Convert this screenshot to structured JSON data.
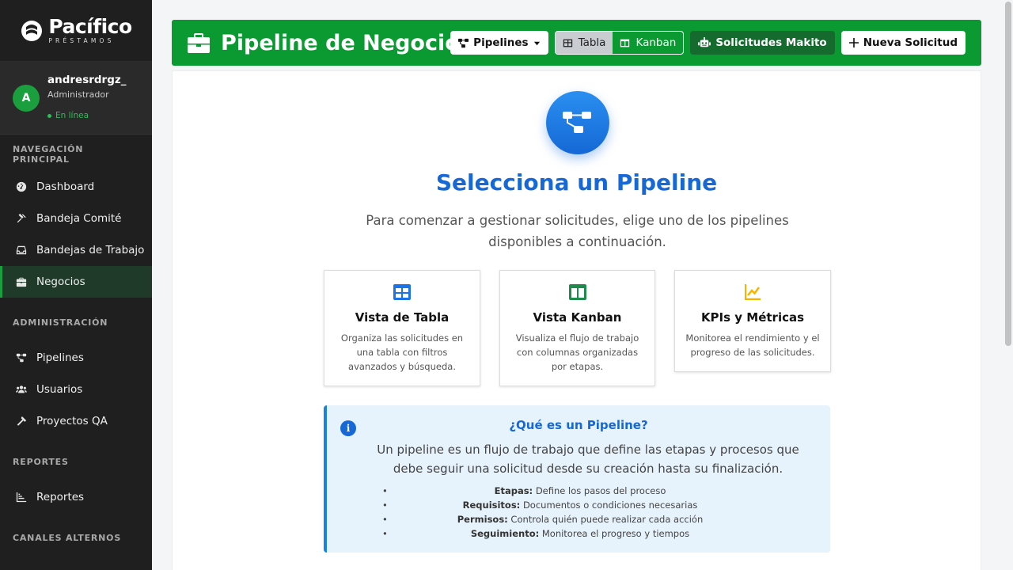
{
  "brand": {
    "name": "Pacífico",
    "sub": "PRÉSTAMOS"
  },
  "user": {
    "initial": "A",
    "name": "andresrdrgz_",
    "role": "Administrador",
    "status": "En línea"
  },
  "sidebar": {
    "sections": [
      {
        "title": "NAVEGACIÓN PRINCIPAL",
        "items": [
          {
            "label": "Dashboard",
            "icon": "gauge-icon"
          },
          {
            "label": "Bandeja Comité",
            "icon": "gavel-icon"
          },
          {
            "label": "Bandejas de Trabajo",
            "icon": "inbox-icon"
          },
          {
            "label": "Negocios",
            "icon": "briefcase-icon",
            "active": true
          }
        ]
      },
      {
        "title": "ADMINISTRACIÓN",
        "items": [
          {
            "label": "Pipelines",
            "icon": "sitemap-icon"
          },
          {
            "label": "Usuarios",
            "icon": "users-icon"
          },
          {
            "label": "Proyectos QA",
            "icon": "hammer-icon"
          }
        ]
      },
      {
        "title": "REPORTES",
        "items": [
          {
            "label": "Reportes",
            "icon": "chart-list-icon"
          }
        ]
      },
      {
        "title": "CANALES ALTERNOS",
        "items": []
      }
    ]
  },
  "header": {
    "title": "Pipeline de Negocio",
    "pipelines_label": "Pipelines",
    "view_table_label": "Tabla",
    "view_kanban_label": "Kanban",
    "makito_label": "Solicitudes Makito",
    "new_label": "Nueva Solicitud"
  },
  "main": {
    "title": "Selecciona un Pipeline",
    "subtitle": "Para comenzar a gestionar solicitudes, elige uno de los pipelines disponibles a continuación.",
    "cards": [
      {
        "title": "Vista de Tabla",
        "desc": "Organiza las solicitudes en una tabla con filtros avanzados y búsqueda.",
        "icon": "table-icon",
        "color": "#1a73e8"
      },
      {
        "title": "Vista Kanban",
        "desc": "Visualiza el flujo de trabajo con columnas organizadas por etapas.",
        "icon": "columns-icon",
        "color": "#1e8a4c"
      },
      {
        "title": "KPIs y Métricas",
        "desc": "Monitorea el rendimiento y el progreso de las solicitudes.",
        "icon": "line-chart-icon",
        "color": "#f5b400"
      }
    ],
    "info": {
      "title": "¿Qué es un Pipeline?",
      "desc": "Un pipeline es un flujo de trabajo que define las etapas y procesos que debe seguir una solicitud desde su creación hasta su finalización.",
      "items": [
        {
          "term": "Etapas:",
          "text": "Define los pasos del proceso"
        },
        {
          "term": "Requisitos:",
          "text": "Documentos o condiciones necesarias"
        },
        {
          "term": "Permisos:",
          "text": "Controla quién puede realizar cada acción"
        },
        {
          "term": "Seguimiento:",
          "text": "Monitorea el progreso y tiempos"
        }
      ]
    }
  },
  "colors": {
    "brand_green": "#0b9a32",
    "accent_blue": "#1568d6",
    "sidebar_bg": "#1f1f1f"
  }
}
